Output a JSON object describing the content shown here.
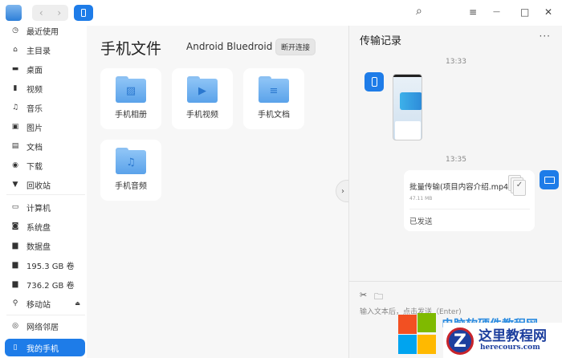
{
  "titlebar": {
    "back": "‹",
    "forward": "›",
    "search_icon": "⌕",
    "menu_icon": "≡",
    "minimize_icon": "—",
    "maximize_icon": "□",
    "close_icon": "✕"
  },
  "sidebar": {
    "items": [
      {
        "label": "最近使用",
        "icon": "clock-icon",
        "glyph": "◷"
      },
      {
        "label": "主目录",
        "icon": "home-icon",
        "glyph": "⌂"
      },
      {
        "label": "桌面",
        "icon": "desktop-icon",
        "glyph": "▬"
      },
      {
        "label": "视频",
        "icon": "video-icon",
        "glyph": "▮"
      },
      {
        "label": "音乐",
        "icon": "music-icon",
        "glyph": "♫"
      },
      {
        "label": "图片",
        "icon": "picture-icon",
        "glyph": "▣"
      },
      {
        "label": "文档",
        "icon": "document-icon",
        "glyph": "▤"
      },
      {
        "label": "下载",
        "icon": "download-icon",
        "glyph": "◉"
      },
      {
        "label": "回收站",
        "icon": "trash-icon",
        "glyph": "▼"
      },
      {
        "label": "计算机",
        "icon": "computer-icon",
        "glyph": "▭"
      },
      {
        "label": "系统盘",
        "icon": "disk-icon",
        "glyph": "◙"
      },
      {
        "label": "数据盘",
        "icon": "disk-icon",
        "glyph": "▆"
      },
      {
        "label": "195.3 GB 卷",
        "icon": "disk-icon",
        "glyph": "▆"
      },
      {
        "label": "736.2 GB 卷",
        "icon": "disk-icon",
        "glyph": "▆"
      },
      {
        "label": "移动站",
        "icon": "usb-icon",
        "glyph": "⚲"
      },
      {
        "label": "网络邻居",
        "icon": "network-icon",
        "glyph": "◎"
      },
      {
        "label": "我的手机",
        "icon": "phone-icon",
        "glyph": "▯"
      }
    ],
    "eject_icon": "⏏"
  },
  "main": {
    "title": "手机文件",
    "device": "Android Bluedroid",
    "disconnect": "断开连接",
    "folders": [
      {
        "label": "手机相册",
        "glyph": "▨"
      },
      {
        "label": "手机视频",
        "glyph": "▶"
      },
      {
        "label": "手机文档",
        "glyph": "≡"
      },
      {
        "label": "手机音频",
        "glyph": "♫"
      }
    ]
  },
  "collapse_icon": "›",
  "transfer": {
    "title": "传输记录",
    "more": "···",
    "time1": "13:33",
    "time2": "13:35",
    "file_name": "批量传输(项目内容介绍.mp4)",
    "file_size": "47.11 MB",
    "status": "已发送",
    "input_placeholder": "输入文本后，点击发送（Enter)",
    "cut_icon": "✂",
    "folder_icon": "🗀"
  },
  "watermark": {
    "top": "电脑软硬件教程网",
    "cn": "这里教程网",
    "url": "herecours.com",
    "letter": "Z"
  },
  "colors": {
    "accent": "#1e7ce8",
    "folder": "#6aaeee"
  }
}
